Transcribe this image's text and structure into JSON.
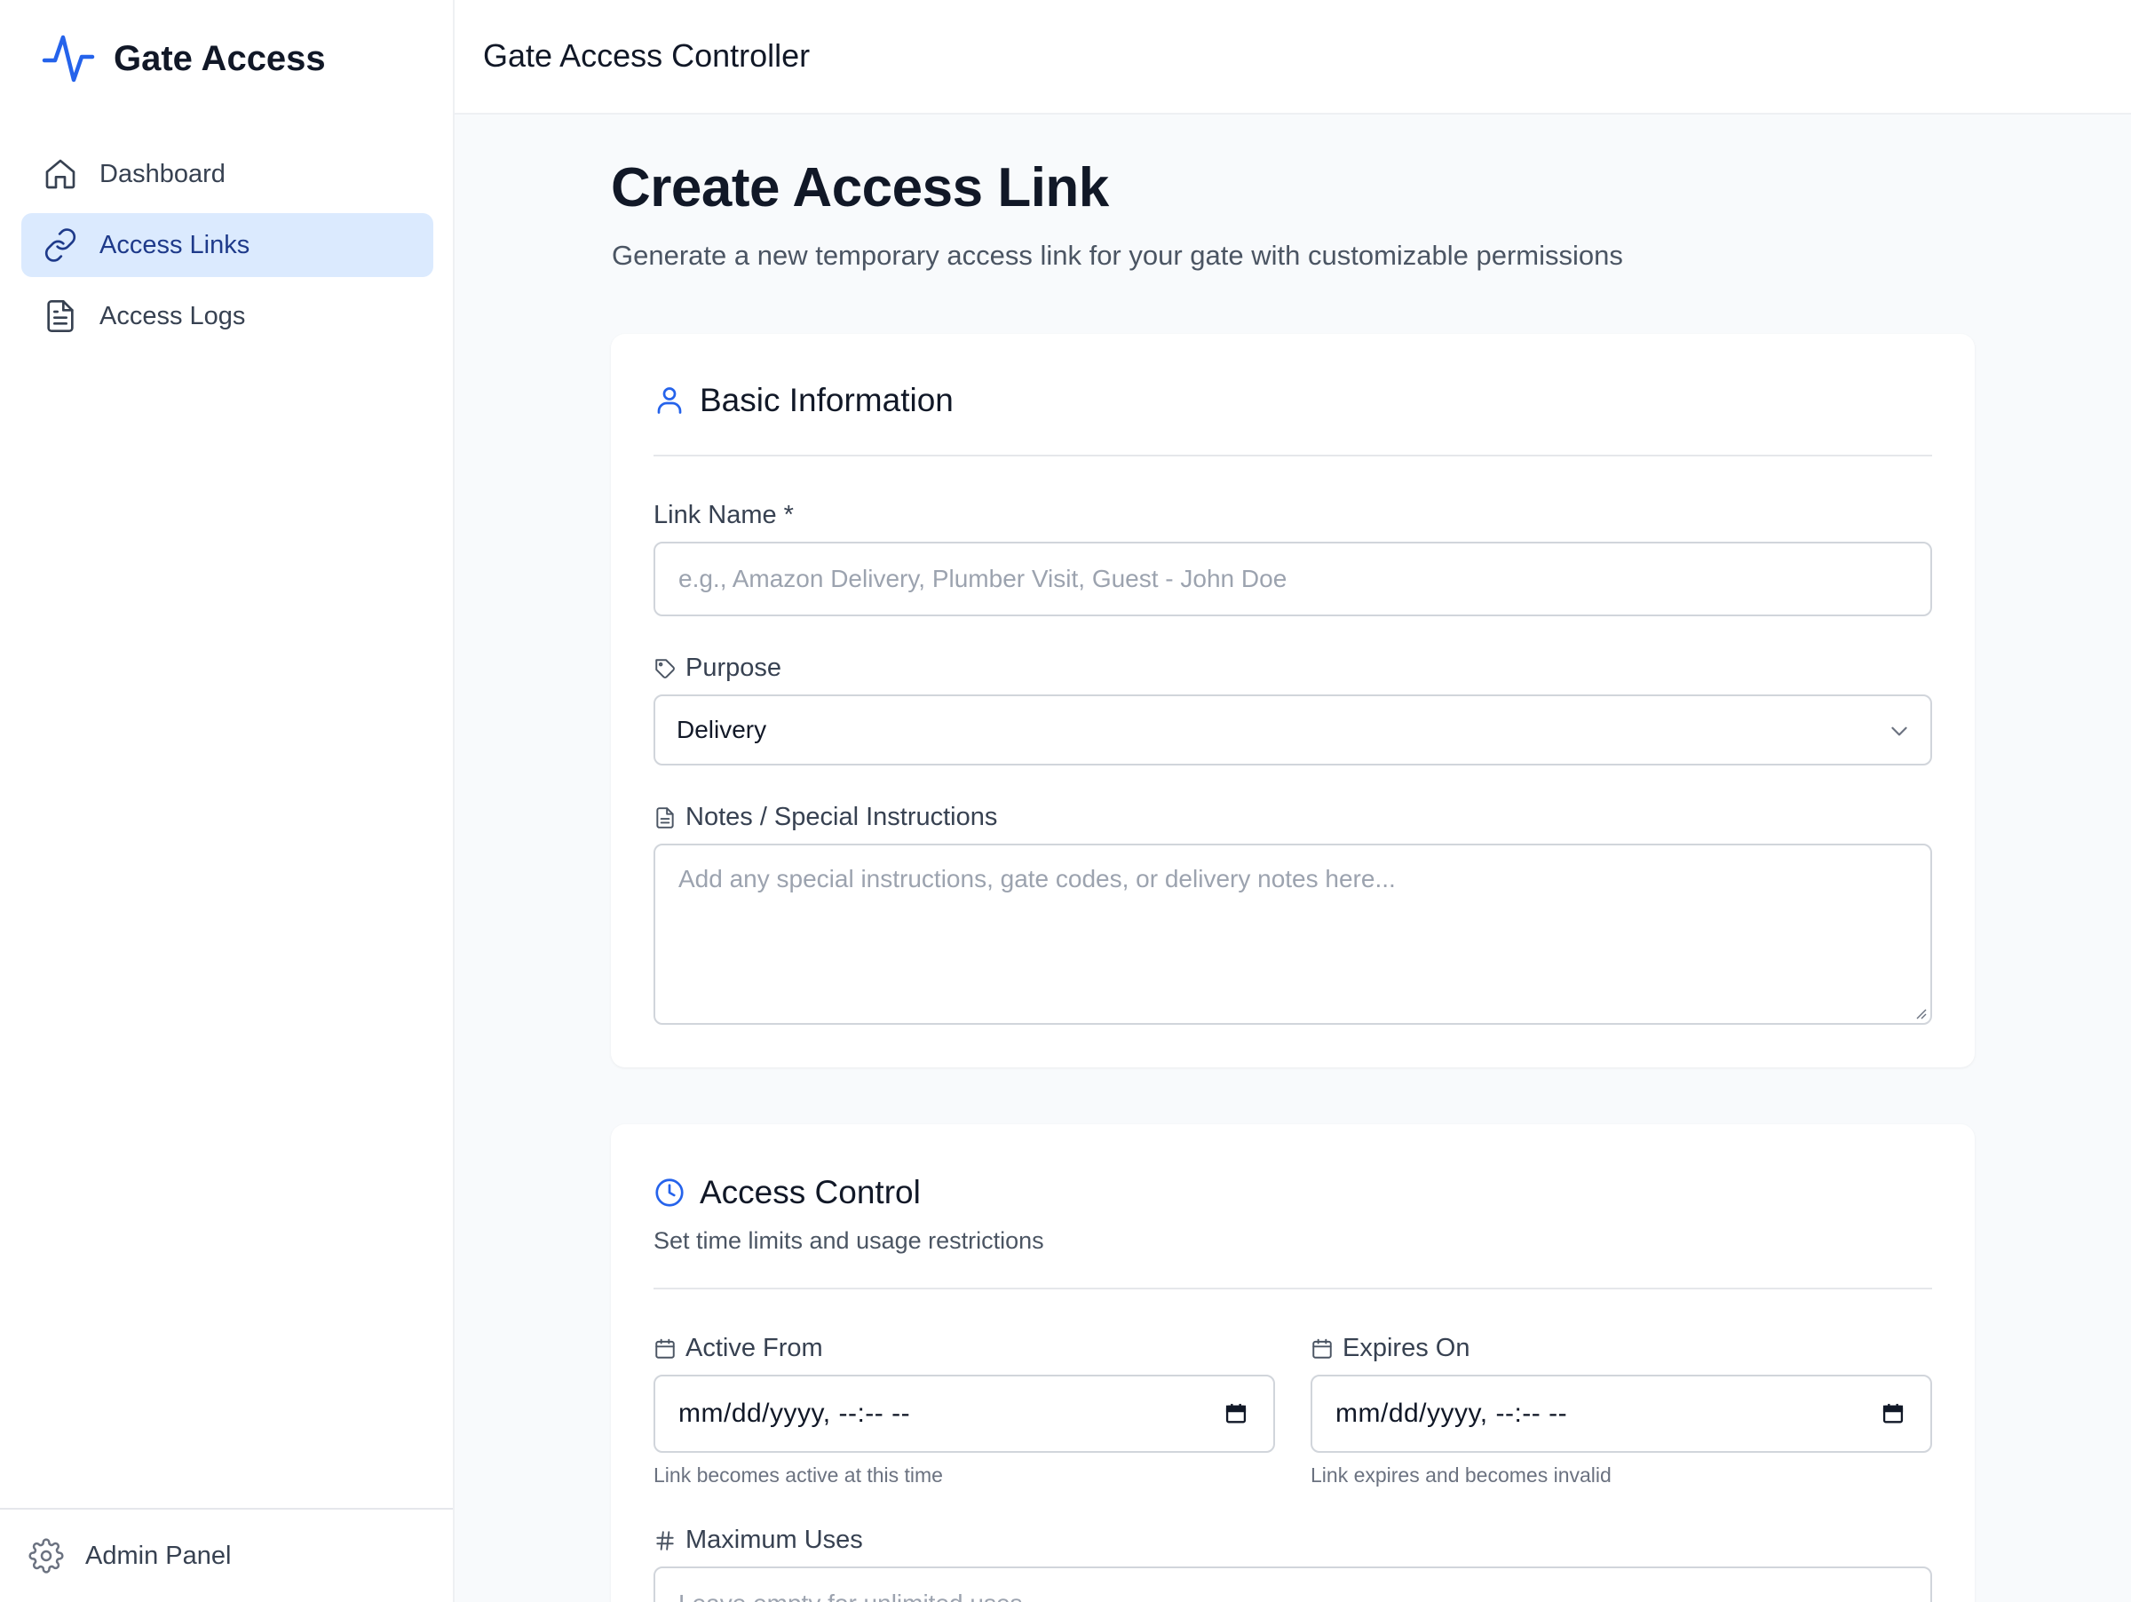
{
  "brand": {
    "name": "Gate Access",
    "accent": "#2563eb"
  },
  "nav": {
    "items": [
      {
        "label": "Dashboard",
        "icon": "home-icon",
        "active": false
      },
      {
        "label": "Access Links",
        "icon": "link-icon",
        "active": true
      },
      {
        "label": "Access Logs",
        "icon": "file-text-icon",
        "active": false
      }
    ]
  },
  "footer": {
    "label": "Admin Panel",
    "icon": "gear-icon"
  },
  "topbar": {
    "title": "Gate Access Controller"
  },
  "page": {
    "title": "Create Access Link",
    "subtitle": "Generate a new temporary access link for your gate with customizable permissions"
  },
  "basic": {
    "heading": "Basic Information",
    "link_name_label": "Link Name *",
    "link_name_placeholder": "e.g., Amazon Delivery, Plumber Visit, Guest - John Doe",
    "purpose_label": "Purpose",
    "purpose_value": "Delivery",
    "notes_label": "Notes / Special Instructions",
    "notes_placeholder": "Add any special instructions, gate codes, or delivery notes here..."
  },
  "access": {
    "heading": "Access Control",
    "description": "Set time limits and usage restrictions",
    "active_from_label": "Active From",
    "active_from_value": "mm/dd/yyyy, --:-- --",
    "active_from_help": "Link becomes active at this time",
    "expires_label": "Expires On",
    "expires_value": "mm/dd/yyyy, --:-- --",
    "expires_help": "Link expires and becomes invalid",
    "max_uses_label": "Maximum Uses",
    "max_uses_placeholder": "Leave empty for unlimited uses"
  }
}
